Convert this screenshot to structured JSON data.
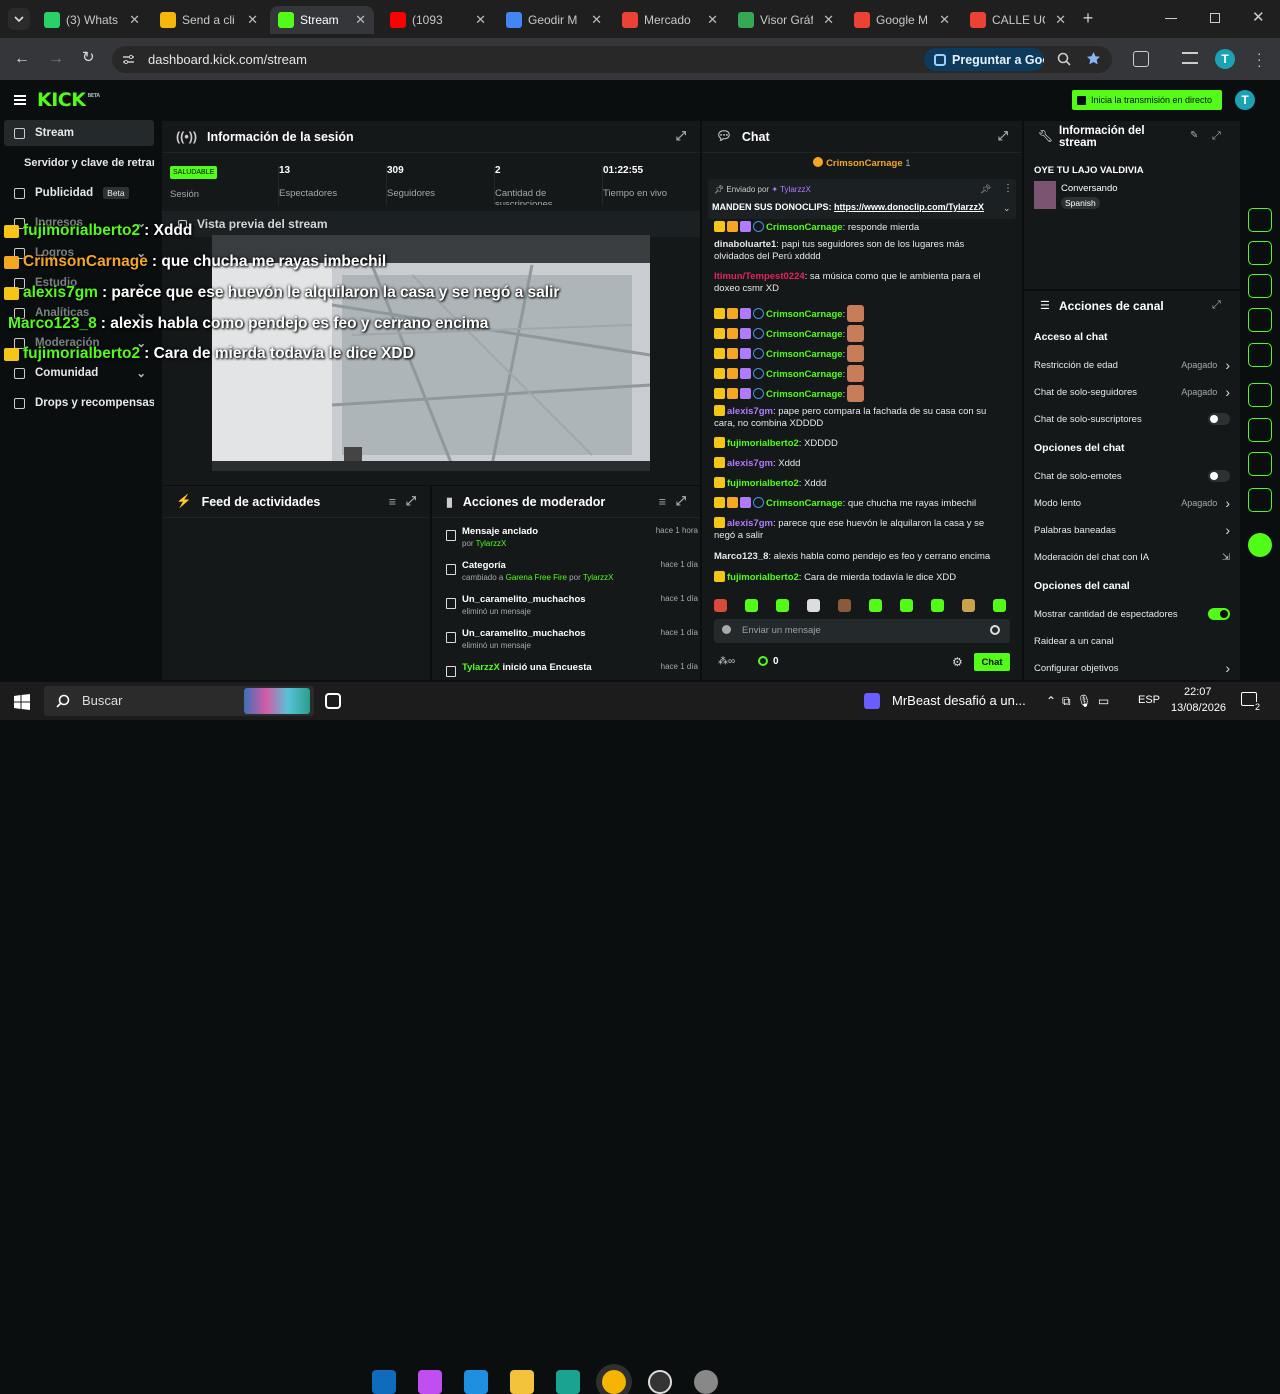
{
  "browser": {
    "tabs": [
      {
        "title": "(3) Whats",
        "icon": "whatsapp-icon",
        "color": "#25d366"
      },
      {
        "title": "Send a cli",
        "icon": "send-icon",
        "color": "#f5b70a"
      },
      {
        "title": "Stream",
        "icon": "kick-icon",
        "color": "#53fc18",
        "active": true
      },
      {
        "title": "(1093",
        "icon": "youtube-icon",
        "color": "#ff0000"
      },
      {
        "title": "Geodir M",
        "icon": "map-pin-icon",
        "color": "#4285f4"
      },
      {
        "title": "Mercado",
        "icon": "map-pin-icon",
        "color": "#ea4335"
      },
      {
        "title": "Visor Gráf",
        "icon": "map-pin-icon",
        "color": "#34a853"
      },
      {
        "title": "Google M",
        "icon": "map-pin-icon",
        "color": "#ea4335"
      },
      {
        "title": "CALLE UC",
        "icon": "map-pin-icon",
        "color": "#ea4335"
      }
    ],
    "url": "dashboard.kick.com/stream",
    "ask_button": "Preguntar a Goo",
    "profile_letter": "T"
  },
  "header": {
    "logo": "KICK",
    "logo_sup": "BETA",
    "go_live": "Inicia la transmisión en directo",
    "avatar_letter": "T"
  },
  "sidebar": {
    "items": [
      {
        "label": "Stream",
        "icon": "stream-icon"
      },
      {
        "label": "Servidor y clave de retransmisión",
        "icon": ""
      },
      {
        "label": "Publicidad",
        "icon": "megaphone-icon",
        "badge": "Beta"
      },
      {
        "label": "Ingresos",
        "icon": "money-icon"
      },
      {
        "label": "Logros",
        "icon": "trophy-icon"
      },
      {
        "label": "Estudio",
        "icon": "studio-icon"
      },
      {
        "label": "Analíticas",
        "icon": "chart-icon"
      },
      {
        "label": "Moderación",
        "icon": "shield-icon"
      },
      {
        "label": "Comunidad",
        "icon": "community-icon"
      },
      {
        "label": "Drops y recompensas",
        "icon": "gift-icon"
      }
    ]
  },
  "session": {
    "title": "Información de la sesión",
    "status": "SALUDABLE",
    "status_label": "Sesión",
    "stats": [
      {
        "value": "13",
        "label": "Espectadores"
      },
      {
        "value": "309",
        "label": "Seguidores"
      },
      {
        "value": "2",
        "label": "Cantidad de suscripciones"
      },
      {
        "value": "01:22:55",
        "label": "Tiempo en vivo"
      }
    ],
    "preview_title": "Vista previa del stream"
  },
  "overlay_chat": [
    {
      "user": "fujimorialberto2",
      "text": ": Xddd"
    },
    {
      "user": "CrimsonCarnage",
      "text": ": que chucha me rayas imbechil"
    },
    {
      "user": "alexis7gm",
      "text": ": parece que ese huevón le alquilaron la casa y se negó a salir"
    },
    {
      "user": "Marco123_8",
      "text": ": alexis habla como pendejo es feo y cerrano encima"
    },
    {
      "user": "fujimorialberto2",
      "text": ": Cara de mierda todavía le dice XDD"
    }
  ],
  "activity_feed": {
    "title": "Feed de actividades"
  },
  "mod_actions": {
    "title": "Acciones de moderador",
    "items": [
      {
        "title": "Mensaje anclado",
        "sub": "por ",
        "user": "TylarzzX",
        "time": "hace 1 hora",
        "icon": "pin-icon"
      },
      {
        "title": "Categoría",
        "sub": "cambiado a ",
        "cat": "Garena Free Fire",
        "sub2": " por ",
        "user": "TylarzzX",
        "time": "hace 1 día",
        "icon": "category-icon"
      },
      {
        "title": "Un_caramelito_muchachos",
        "sub": "eliminó un mensaje",
        "time": "hace 1 día",
        "icon": "trash-icon"
      },
      {
        "title": "Un_caramelito_muchachos",
        "sub": "eliminó un mensaje",
        "time": "hace 1 día",
        "icon": "trash-icon"
      },
      {
        "title": "TylarzzX",
        "title2": " inició una Encuesta",
        "time": "hace 1 día",
        "icon": "poll-icon"
      }
    ]
  },
  "chat": {
    "title": "Chat",
    "top_user": "CrimsonCarnage",
    "top_count": "1",
    "pinned_by_label": "Enviado por",
    "pinned_by": "TylarzzX",
    "pinned_text": "MANDEN SUS DONOCLIPS: ",
    "pinned_link": "https://www.donoclip.com/TylarzzX",
    "messages": [
      {
        "user": "CrimsonCarnage",
        "text": ": responde mierda",
        "color": "#53fc18"
      },
      {
        "user": "dinaboluarte1",
        "text": ": papi tus seguidores son de los lugares más olvidados del Perú xdddd",
        "color": "#e8e8e8"
      },
      {
        "user": "Itimun/Tempest0224",
        "text": ": sa música como que le ambienta para el doxeo csmr XD",
        "color": "#e0245e"
      },
      {
        "user": "CrimsonCarnage",
        "text": ":",
        "color": "#53fc18"
      },
      {
        "user": "CrimsonCarnage",
        "text": ":",
        "color": "#53fc18"
      },
      {
        "user": "CrimsonCarnage",
        "text": ":",
        "color": "#53fc18"
      },
      {
        "user": "CrimsonCarnage",
        "text": ":",
        "color": "#53fc18"
      },
      {
        "user": "CrimsonCarnage",
        "text": ":",
        "color": "#53fc18"
      },
      {
        "user": "alexis7gm",
        "text": ": pape pero compara la fachada de su casa con su cara, no combina XDDDD",
        "color": "#b07cff"
      },
      {
        "user": "fujimorialberto2",
        "text": ": XDDDD",
        "color": "#53fc18"
      },
      {
        "user": "alexis7gm",
        "text": ": Xddd",
        "color": "#b07cff"
      },
      {
        "user": "fujimorialberto2",
        "text": ": Xddd",
        "color": "#53fc18"
      },
      {
        "user": "CrimsonCarnage",
        "text": ": que chucha me rayas imbechil",
        "color": "#53fc18"
      },
      {
        "user": "alexis7gm",
        "text": ": parece que ese huevón le alquilaron la casa y se negó a salir",
        "color": "#b07cff"
      },
      {
        "user": "Marco123_8",
        "text": ": alexis habla como pendejo es feo y cerrano encima",
        "color": "#e8e8e8"
      },
      {
        "user": "fujimorialberto2",
        "text": ": Cara de mierda todavía le dice XDD",
        "color": "#53fc18"
      }
    ],
    "input_placeholder": "Enviar un mensaje",
    "points": "0",
    "send": "Chat"
  },
  "stream_info": {
    "title": "Información del stream",
    "stream_title": "OYE TU LAJO VALDIVIA",
    "category": "Conversando",
    "tag": "Spanish"
  },
  "channel_actions": {
    "title": "Acciones de canal",
    "sections": [
      {
        "heading": "Acceso al chat",
        "rows": [
          {
            "label": "Restricción de edad",
            "value": "Apagado",
            "type": "chevron"
          },
          {
            "label": "Chat de solo-seguidores",
            "value": "Apagado",
            "type": "chevron"
          },
          {
            "label": "Chat de solo-suscriptores",
            "value": "",
            "type": "toggle-off"
          }
        ]
      },
      {
        "heading": "Opciones del chat",
        "rows": [
          {
            "label": "Chat de solo-emotes",
            "value": "",
            "type": "toggle-off"
          },
          {
            "label": "Modo lento",
            "value": "Apagado",
            "type": "chevron"
          },
          {
            "label": "Palabras baneadas",
            "value": "",
            "type": "chevron"
          },
          {
            "label": "Moderación del chat con IA",
            "value": "",
            "type": "external"
          }
        ]
      },
      {
        "heading": "Opciones del canal",
        "rows": [
          {
            "label": "Mostrar cantidad de espectadores",
            "value": "",
            "type": "toggle-on"
          },
          {
            "label": "Raidear a un canal",
            "value": "",
            "type": "none"
          },
          {
            "label": "Configurar objetivos",
            "value": "",
            "type": "chevron"
          }
        ]
      }
    ]
  },
  "taskbar": {
    "search": "Buscar",
    "media_title": "MrBeast desafió a un...",
    "lang": "ESP",
    "time": "22:07",
    "date": "13/08/2026",
    "notif": "2"
  }
}
